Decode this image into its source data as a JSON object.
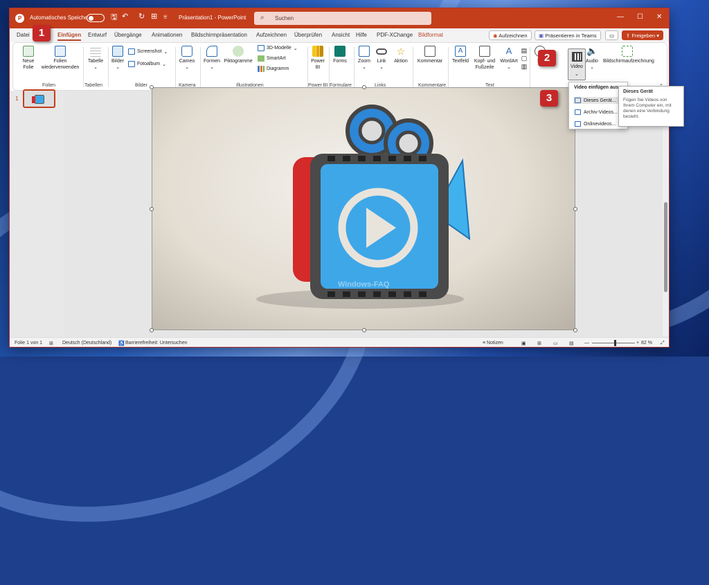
{
  "titlebar": {
    "autosave_label": "Automatisches Speichern",
    "doc_title": "Präsentation1 - PowerPoint",
    "search_placeholder": "Suchen"
  },
  "tabs": [
    "Datei",
    "Einfügen",
    "Entwurf",
    "Übergänge",
    "Animationen",
    "Bildschirmpräsentation",
    "Aufzeichnen",
    "Überprüfen",
    "Ansicht",
    "Hilfe",
    "PDF-XChange",
    "Bildformat"
  ],
  "active_tab": "Einfügen",
  "header_buttons": {
    "record": "Aufzeichnen",
    "present_teams": "Präsentieren in Teams",
    "share": "Freigeben"
  },
  "ribbon": {
    "new_slide": "Neue Folie",
    "reuse_slides": "Folien wiederverwenden",
    "table": "Tabelle",
    "pictures": "Bilder",
    "screenshot": "Screenshot",
    "photo_album": "Fotoalbum",
    "cameo": "Cameo",
    "shapes": "Formen",
    "icons": "Piktogramme",
    "models_3d": "3D-Modelle",
    "smartart": "SmartArt",
    "chart": "Diagramm",
    "power_bi": "Power BI",
    "forms": "Forms",
    "zoom": "Zoom",
    "link": "Link",
    "action": "Aktion",
    "comment": "Kommentar",
    "textbox": "Textfeld",
    "header_footer": "Kopf- und Fußzeile",
    "wordart": "WordArt",
    "symbols": "Sy",
    "video": "Video",
    "audio": "Audio",
    "screen_recording": "Bildschirmaufzeichnung",
    "groups": {
      "slides": "Folien",
      "tables": "Tabellen",
      "images": "Bilder",
      "camera": "Kamera",
      "illustrations": "Illustrationen",
      "powerbi": "Power BI",
      "forms": "Formulare",
      "links": "Links",
      "comments": "Kommentare",
      "text": "Text"
    }
  },
  "video_menu": {
    "header": "Video einfügen aus",
    "items": [
      "Dieses Gerät...",
      "Archiv-Videos...",
      "Onlinevideos..."
    ]
  },
  "tooltip": {
    "title": "Dieses Gerät",
    "body": "Fügen Sie Videos von Ihrem Computer ein, mit denen eine Verbindung besteht."
  },
  "thumbnail_number": "1",
  "badges": [
    "1",
    "2",
    "3"
  ],
  "watermark": "Windows-FAQ",
  "statusbar": {
    "slide_info": "Folie 1 von 1",
    "language": "Deutsch (Deutschland)",
    "accessibility": "Barrierefreiheit: Untersuchen",
    "notes": "Notizen",
    "zoom": "82 %"
  },
  "colors": {
    "accent": "#c43e1c",
    "badge": "#c62828",
    "camera_body": "#3ea7e8",
    "camera_frame": "#d42a2a"
  }
}
